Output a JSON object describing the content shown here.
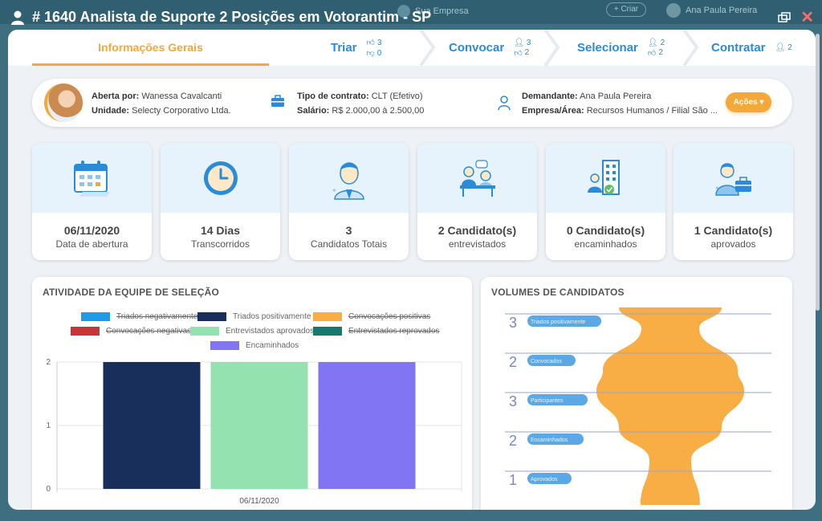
{
  "background": {
    "company_name": "Sua Empresa",
    "button_label": "+ Criar",
    "user_name": "Ana Paula Pereira"
  },
  "modal": {
    "title": "# 1640 Analista de Suporte 2 Posições em Votorantim - SP",
    "close_label": "✕"
  },
  "stepper": {
    "general": "Informações Gerais",
    "triar": {
      "label": "Triar",
      "likes": "3",
      "dislikes": "0"
    },
    "convocar": {
      "label": "Convocar",
      "people": "3",
      "likes": "2"
    },
    "selecionar": {
      "label": "Selecionar",
      "people": "2",
      "likes": "2"
    },
    "contratar": {
      "label": "Contratar",
      "people": "2"
    }
  },
  "info": {
    "aberta_por_label": "Aberta por:",
    "aberta_por": "Wanessa Cavalcanti",
    "unidade_label": "Unidade:",
    "unidade": "Selecty Corporativo Ltda.",
    "tipo_contrato_label": "Tipo de contrato:",
    "tipo_contrato": "CLT (Efetivo)",
    "salario_label": "Salário:",
    "salario": "R$ 2.000,00 à 2.500,00",
    "demandante_label": "Demandante:",
    "demandante": "Ana Paula Pereira",
    "empresa_area_label": "Empresa/Área:",
    "empresa_area": "Recursos Humanos / Filial São ...",
    "acoes_label": "Ações"
  },
  "cards": [
    {
      "value": "06/11/2020",
      "label": "Data de abertura",
      "icon": "calendar-icon"
    },
    {
      "value": "14 Dias",
      "label": "Transcorridos",
      "icon": "clock-icon"
    },
    {
      "value": "3",
      "label": "Candidatos Totais",
      "icon": "candidate-icon"
    },
    {
      "value": "2 Candidato(s)",
      "label": "entrevistados",
      "icon": "interview-icon"
    },
    {
      "value": "0 Candidato(s)",
      "label": "encaminhados",
      "icon": "building-icon"
    },
    {
      "value": "1 Candidato(s)",
      "label": "aprovados",
      "icon": "briefcase-icon"
    }
  ],
  "colors": {
    "accent": "#f4a83a",
    "primary": "#2a8bd8",
    "funnel": "#f9ad45"
  },
  "chart_data": [
    {
      "type": "bar",
      "title": "ATIVIDADE DA EQUIPE DE SELEÇÃO",
      "categories": [
        "06/11/2020"
      ],
      "legend": [
        {
          "name": "Triados negativamente",
          "color": "#1e9ae8",
          "hidden": true
        },
        {
          "name": "Triados positivamente",
          "color": "#182f5c",
          "hidden": false
        },
        {
          "name": "Convocações positivas",
          "color": "#f9ad45",
          "hidden": true
        },
        {
          "name": "Convocações negativas",
          "color": "#c73636",
          "hidden": true
        },
        {
          "name": "Entrevistados aprovados",
          "color": "#93e2b0",
          "hidden": false
        },
        {
          "name": "Entrevistados reprovados",
          "color": "#16786e",
          "hidden": true
        },
        {
          "name": "Encaminhados",
          "color": "#8275f4",
          "hidden": false
        }
      ],
      "series": [
        {
          "name": "Triados positivamente",
          "values": [
            2
          ],
          "color": "#182f5c"
        },
        {
          "name": "Entrevistados aprovados",
          "values": [
            2
          ],
          "color": "#93e2b0"
        },
        {
          "name": "Encaminhados",
          "values": [
            2
          ],
          "color": "#8275f4"
        }
      ],
      "yticks": [
        "0",
        "1",
        "2"
      ],
      "ylim": [
        0,
        2
      ],
      "grid": true,
      "legend_position": "top"
    },
    {
      "type": "area",
      "title": "VOLUMES DE CANDIDATOS",
      "stages": [
        {
          "name": "Triados positivamente",
          "value": 3
        },
        {
          "name": "Convocados",
          "value": 2
        },
        {
          "name": "Participantes",
          "value": 3
        },
        {
          "name": "Encaminhados",
          "value": 2
        },
        {
          "name": "Aprovados",
          "value": 1
        }
      ],
      "color": "#f9ad45"
    }
  ]
}
